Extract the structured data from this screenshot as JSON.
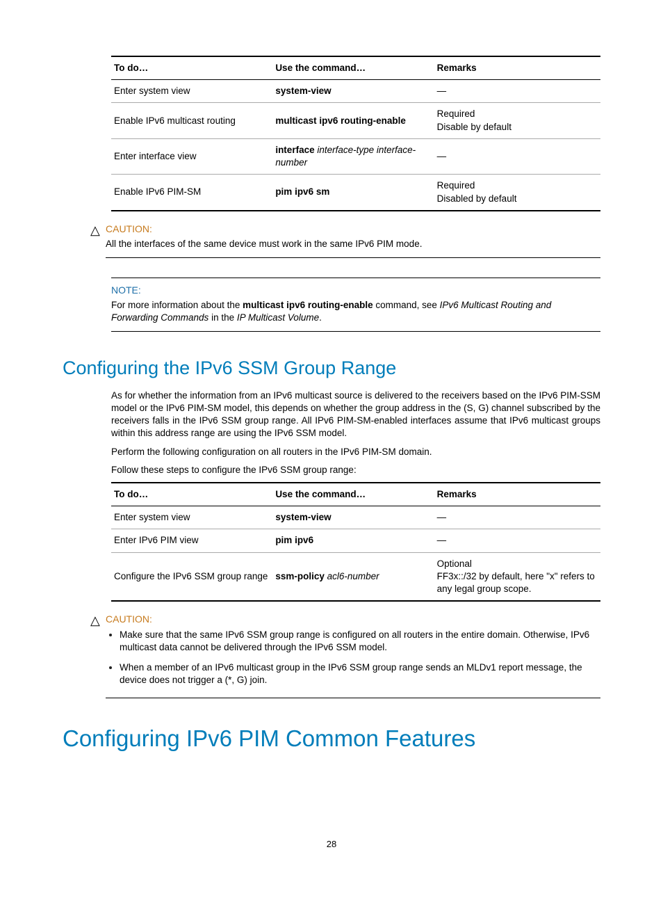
{
  "table1": {
    "headers": {
      "c1": "To do…",
      "c2": "Use the command…",
      "c3": "Remarks"
    },
    "rows": [
      {
        "todo": "Enter system view",
        "cmd_b": "system-view",
        "cmd_i": "",
        "remarks": "—"
      },
      {
        "todo": "Enable IPv6 multicast routing",
        "cmd_b": "multicast ipv6 routing-enable",
        "cmd_i": "",
        "remarks": "Required\nDisable by default"
      },
      {
        "todo": "Enter interface view",
        "cmd_b": "interface",
        "cmd_i": " interface-type interface-number",
        "remarks": "—"
      },
      {
        "todo": "Enable IPv6 PIM-SM",
        "cmd_b": "pim ipv6 sm",
        "cmd_i": "",
        "remarks": "Required\nDisabled by default"
      }
    ]
  },
  "caution1": {
    "title": "CAUTION:",
    "text": "All the interfaces of the same device must work in the same IPv6 PIM mode."
  },
  "note1": {
    "title": "NOTE:",
    "text_pre": "For more information about the ",
    "text_bold": "multicast ipv6 routing-enable",
    "text_mid": " command, see ",
    "text_ital1": "IPv6 Multicast Routing and Forwarding Commands",
    "text_mid2": " in the ",
    "text_ital2": "IP Multicast Volume",
    "text_post": "."
  },
  "section2": {
    "heading": "Configuring the IPv6 SSM Group Range",
    "p1": "As for whether the information from an IPv6 multicast source is delivered to the receivers based on the IPv6 PIM-SSM model or the IPv6 PIM-SM model, this depends on whether the group address in the (S, G) channel subscribed by the receivers falls in the IPv6 SSM group range. All IPv6 PIM-SM-enabled interfaces assume that IPv6 multicast groups within this address range are using the IPv6 SSM model.",
    "p2": "Perform the following configuration on all routers in the IPv6 PIM-SM domain.",
    "p3": "Follow these steps to configure the IPv6 SSM group range:"
  },
  "table2": {
    "headers": {
      "c1": "To do…",
      "c2": "Use the command…",
      "c3": "Remarks"
    },
    "rows": [
      {
        "todo": "Enter system view",
        "cmd_b": "system-view",
        "cmd_i": "",
        "remarks": "—"
      },
      {
        "todo": "Enter IPv6 PIM view",
        "cmd_b": "pim ipv6",
        "cmd_i": "",
        "remarks": "—"
      },
      {
        "todo": "Configure the IPv6 SSM group range",
        "cmd_b": "ssm-policy",
        "cmd_i": " acl6-number",
        "remarks": "Optional\nFF3x::/32 by default, here \"x\" refers to any legal group scope."
      }
    ]
  },
  "caution2": {
    "title": "CAUTION:",
    "items": [
      "Make sure that the same IPv6 SSM group range is configured on all routers in the entire domain. Otherwise, IPv6 multicast data cannot be delivered through the IPv6 SSM model.",
      "When a member of an IPv6 multicast group in the IPv6 SSM group range sends an MLDv1 report message, the device does not trigger a (*, G) join."
    ]
  },
  "chapter": {
    "heading": "Configuring IPv6 PIM Common Features"
  },
  "page_number": "28"
}
